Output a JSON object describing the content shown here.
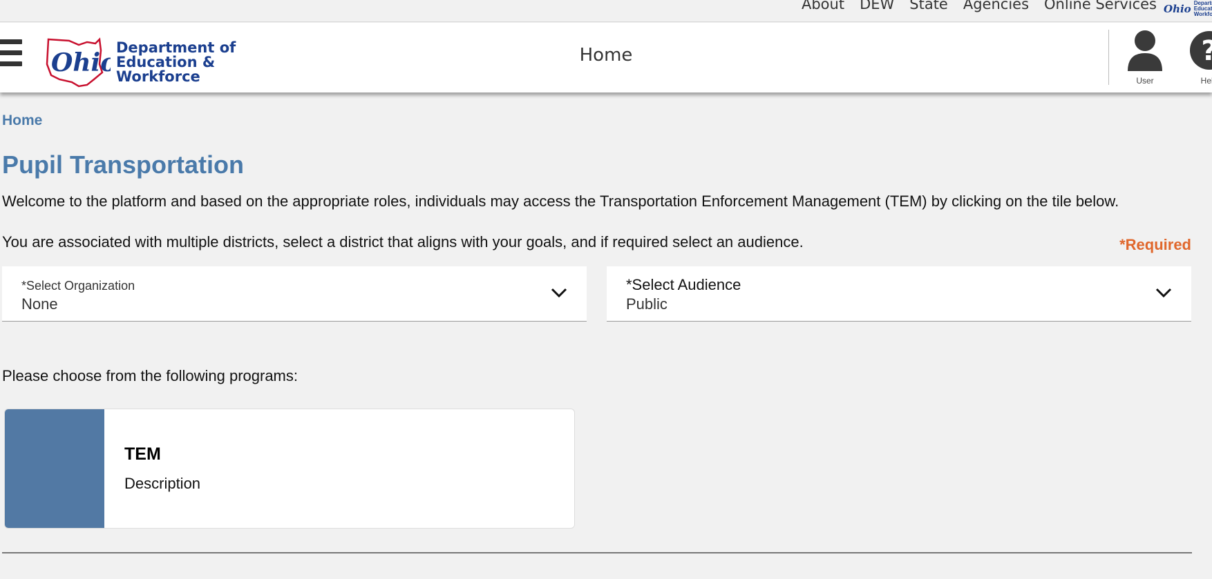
{
  "topbar": {
    "links": [
      "About",
      "DEW",
      "State",
      "Agencies",
      "Online Services"
    ],
    "logo_text": "Ohio",
    "logo_sub": [
      "Departm",
      "Educatio",
      "Workforc"
    ]
  },
  "header": {
    "title": "Home",
    "brand_ohio": "Ohio",
    "brand_lines": [
      "Department of",
      "Education &",
      "Workforce"
    ],
    "user_label": "User",
    "help_label": "Help"
  },
  "breadcrumb": "Home",
  "page_title": "Pupil Transportation",
  "welcome_text": "Welcome to the platform and based on the appropriate roles, individuals may access the Transportation Enforcement Management (TEM) by clicking on the tile below.",
  "associated_text": "You are associated with multiple districts, select a district that aligns with your goals, and if required select an audience.",
  "required_label": "*Required",
  "organization_select": {
    "label": "*Select Organization",
    "value": "None"
  },
  "audience_select": {
    "label": "*Select Audience",
    "value": "Public"
  },
  "choose_text": "Please choose from the following programs:",
  "program_card": {
    "title": "TEM",
    "description": "Description"
  },
  "colors": {
    "accent_blue": "#4a7aaa",
    "card_accent": "#5279a4",
    "required_orange": "#e0672c",
    "brand_navy": "#1b3f8f",
    "brand_red": "#c8102e"
  }
}
